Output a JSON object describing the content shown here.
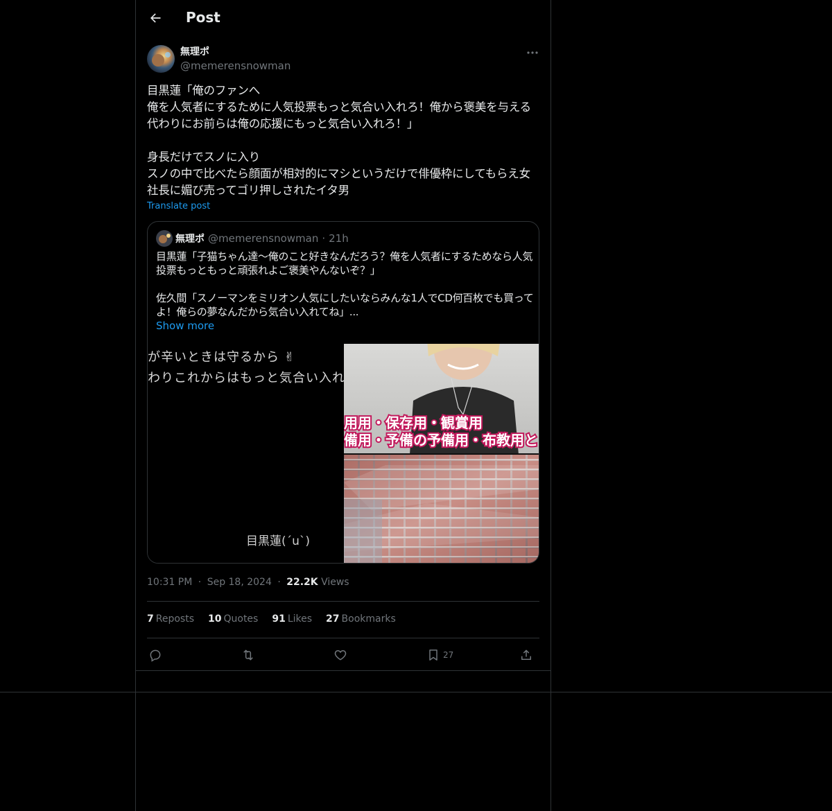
{
  "header": {
    "title": "Post"
  },
  "post": {
    "author": {
      "display_name": "無理ポ",
      "handle": "@memerensnowman"
    },
    "text": "目黒蓮「俺のファンへ\n俺を人気者にするために人気投票もっと気合い入れろ！俺から褒美を与える代わりにお前らは俺の応援にもっと気合い入れろ！」\n\n身長だけでスノに入り\nスノの中で比べたら顔面が相対的にマシというだけで俳優枠にしてもらえ女社長に媚び売ってゴリ押しされたイタ男",
    "translate_label": "Translate post",
    "quote": {
      "display_name": "無理ポ",
      "handle": "@memerensnowman",
      "dot": "·",
      "time": "21h",
      "text": "目黒蓮「子猫ちゃん達〜俺のこと好きなんだろう？俺を人気者にするためなら人気投票もっともっと頑張れよご褒美やんないぞ？」\n\n佐久間「スノーマンをミリオン人気にしたいならみんな1人でCD何百枚でも買ってよ！俺らの夢なんだから気合い入れてね」...",
      "show_more": "Show more",
      "media_left": {
        "line1": "が辛いときは守るから ✌",
        "line2": "わりこれからはもっと気合い入れ",
        "caption": "目黒蓮(´u`)"
      },
      "media_right": {
        "caption_line1": "用用・保存用・観賞用",
        "caption_line2": "備用・予備の予備用・布教用と"
      }
    },
    "meta": {
      "time": "10:31 PM",
      "date": "Sep 18, 2024",
      "views_count": "22.2K",
      "views_label": "Views",
      "sep": "·"
    },
    "stats": [
      {
        "count": "7",
        "label": "Reposts"
      },
      {
        "count": "10",
        "label": "Quotes"
      },
      {
        "count": "91",
        "label": "Likes"
      },
      {
        "count": "27",
        "label": "Bookmarks"
      }
    ],
    "actions": {
      "bookmark_count": "27"
    }
  },
  "colors": {
    "accent": "#1d9bf0",
    "border": "#2f3336",
    "muted": "#71767b",
    "text": "#e7e9ea",
    "bg": "#000000"
  },
  "icons": [
    "back-arrow-icon",
    "more-icon",
    "reply-icon",
    "repost-icon",
    "like-icon",
    "bookmark-icon",
    "share-icon"
  ]
}
